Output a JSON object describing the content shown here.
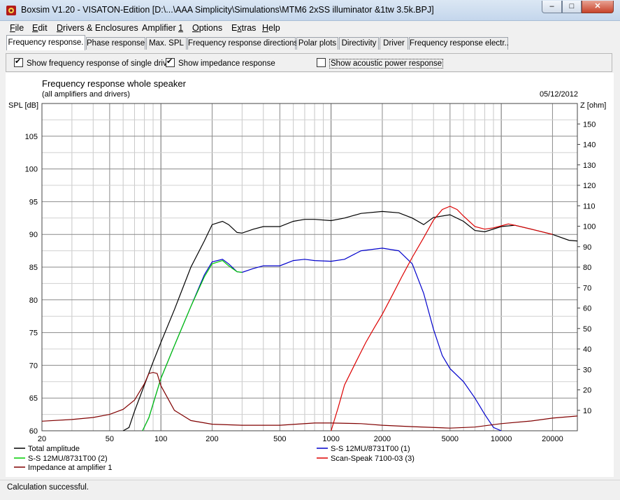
{
  "window": {
    "title": "Boxsim V1.20 - VISATON-Edition [D:\\...\\AAA Simplicity\\Simulations\\MTM6 2xSS illuminator &1tw 3.5k.BPJ]",
    "min_glyph": "–",
    "max_glyph": "□",
    "close_glyph": "✕"
  },
  "menu": [
    {
      "label": "File",
      "u": "F",
      "rest": "ile"
    },
    {
      "label": "Edit",
      "u": "E",
      "rest": "dit"
    },
    {
      "label": "Drivers & Enclosures",
      "u": "D",
      "rest": "rivers & Enclosures"
    },
    {
      "label": "Amplifier 1",
      "pre": "Amplifier ",
      "u": "1",
      "rest": ""
    },
    {
      "label": "Options",
      "u": "O",
      "rest": "ptions"
    },
    {
      "label": "Extras",
      "pre": "E",
      "u": "x",
      "rest": "tras"
    },
    {
      "label": "Help",
      "u": "H",
      "rest": "elp"
    }
  ],
  "tabs": [
    {
      "label": "Frequency response.",
      "active": true
    },
    {
      "label": "Phase response"
    },
    {
      "label": "Max. SPL"
    },
    {
      "label": "Frequency response directions"
    },
    {
      "label": "Polar plots"
    },
    {
      "label": "Directivity"
    },
    {
      "label": "Driver"
    },
    {
      "label": "Frequency response electr.."
    }
  ],
  "options": {
    "single_drive": {
      "label": "Show frequency response of single drive",
      "checked": true
    },
    "impedance": {
      "label": "Show impedance response",
      "checked": true
    },
    "acoustic_power": {
      "label": "Show acoustic power response",
      "checked": false
    }
  },
  "status": "Calculation successful.",
  "chart_data": {
    "type": "line",
    "title": "Frequency response whole speaker",
    "subtitle": "(all amplifiers and drivers)",
    "date": "05/12/2012",
    "ylabel": "SPL [dB]",
    "y2label": "Z [ohm]",
    "x_scale": "log",
    "xlim": [
      20,
      28000
    ],
    "ylim": [
      60,
      110
    ],
    "y2lim": [
      0,
      160
    ],
    "x_ticks": [
      20,
      50,
      100,
      200,
      500,
      1000,
      2000,
      5000,
      10000,
      20000
    ],
    "y_ticks": [
      60,
      65,
      70,
      75,
      80,
      85,
      90,
      95,
      100,
      105
    ],
    "y2_ticks": [
      10,
      20,
      30,
      40,
      50,
      60,
      70,
      80,
      90,
      100,
      110,
      120,
      130,
      140,
      150
    ],
    "grid": true,
    "colors": {
      "total": "#000000",
      "ss1": "#0000cc",
      "ss2": "#00cc00",
      "tweeter": "#dd0000",
      "impedance": "#800000"
    },
    "series": [
      {
        "name": "Total amplitude",
        "color": "#000000",
        "axis": "left",
        "x": [
          60,
          65,
          70,
          80,
          90,
          100,
          120,
          150,
          180,
          200,
          230,
          250,
          280,
          300,
          350,
          400,
          500,
          600,
          700,
          800,
          1000,
          1200,
          1500,
          2000,
          2500,
          3000,
          3500,
          4000,
          5000,
          6000,
          7000,
          8000,
          10000,
          12000,
          15000,
          20000,
          25000,
          28000
        ],
        "y": [
          60,
          60.5,
          63,
          67,
          70.5,
          73.5,
          78.5,
          85,
          89,
          91.5,
          92,
          91.5,
          90.3,
          90.2,
          90.8,
          91.2,
          91.2,
          92,
          92.3,
          92.3,
          92.1,
          92.5,
          93.2,
          93.5,
          93.3,
          92.5,
          91.5,
          92.6,
          93,
          92,
          90.6,
          90.4,
          91.2,
          91.4,
          90.8,
          90,
          89.1,
          89
        ]
      },
      {
        "name": "S-S 12MU/8731T00 (1)",
        "color": "#0000cc",
        "axis": "left",
        "x": [
          78,
          85,
          100,
          120,
          150,
          180,
          200,
          230,
          250,
          280,
          300,
          350,
          400,
          500,
          600,
          700,
          800,
          1000,
          1200,
          1500,
          2000,
          2500,
          3000,
          3500,
          4000,
          4500,
          5000,
          6000,
          7000,
          8000,
          9000,
          10000
        ],
        "y": [
          60,
          62,
          68,
          73,
          79,
          83.8,
          85.8,
          86.2,
          85.5,
          84.3,
          84.2,
          84.8,
          85.2,
          85.2,
          86,
          86.2,
          86,
          85.9,
          86.2,
          87.5,
          87.9,
          87.5,
          85.5,
          81,
          75.5,
          71.5,
          69.5,
          67.5,
          65,
          62.5,
          60.5,
          60
        ]
      },
      {
        "name": "S-S 12MU/8731T00 (2)",
        "color": "#00cc00",
        "axis": "left",
        "x": [
          78,
          85,
          100,
          120,
          150,
          180,
          200,
          230,
          250,
          280,
          300
        ],
        "y": [
          60,
          62,
          68,
          73,
          79,
          83.5,
          85.5,
          86,
          85.2,
          84.3,
          84.2
        ]
      },
      {
        "name": "Scan-Speak 7100-03 (3)",
        "color": "#dd0000",
        "axis": "left",
        "x": [
          1000,
          1100,
          1200,
          1400,
          1600,
          1800,
          2000,
          2300,
          2600,
          3000,
          3500,
          4000,
          4500,
          5000,
          5500,
          6000,
          7000,
          8000,
          9000,
          10000,
          11000,
          12000,
          15000,
          20000
        ],
        "y": [
          60,
          63.5,
          67,
          70.5,
          73.5,
          75.8,
          77.8,
          80.8,
          83.5,
          86.5,
          89.5,
          92.2,
          93.8,
          94.3,
          93.8,
          92.8,
          91.2,
          90.8,
          91,
          91.3,
          91.6,
          91.4,
          90.8,
          90
        ]
      },
      {
        "name": "Impedance at amplifier 1",
        "color": "#800000",
        "axis": "right",
        "x": [
          20,
          30,
          40,
          50,
          60,
          70,
          80,
          85,
          90,
          95,
          100,
          120,
          150,
          200,
          300,
          500,
          800,
          1000,
          1500,
          2000,
          3000,
          5000,
          7000,
          10000,
          15000,
          20000,
          28000
        ],
        "y": [
          4.7,
          5.5,
          6.5,
          8,
          10.5,
          15,
          23,
          28,
          28.5,
          28,
          22,
          10,
          5,
          3.2,
          2.7,
          2.7,
          3.8,
          3.8,
          3.5,
          2.7,
          2,
          1.3,
          1.8,
          3.5,
          4.8,
          6.2,
          7.2
        ]
      }
    ]
  }
}
